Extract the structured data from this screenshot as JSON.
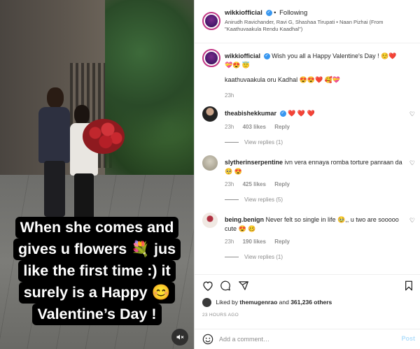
{
  "post": {
    "username": "wikkiofficial",
    "following_label": "Following",
    "song": "Anirudh Ravichander, Ravi G, Shashaa Tirupati • Naan Pizhai (From \"Kaathuvaakula Rendu Kaadhal\")"
  },
  "media": {
    "caption_lines": [
      "When she comes and",
      "gives u flowers 💐 jus",
      "like the first time :) it",
      "surely is a Happy 😊",
      "Valentine’s Day !"
    ],
    "mute_icon": "speaker-muted-icon"
  },
  "caption": {
    "username": "wikkiofficial",
    "text": "Wish you all a Happy Valentine's Day ! ☺️❤️💝😍 😇",
    "line2": "kaathuvaakula oru Kadhal 😍😍❤️ 🥰💝",
    "time": "23h"
  },
  "comments": [
    {
      "username": "theabishekkumar",
      "text": "❤️ ❤️ ❤️",
      "time": "23h",
      "likes": "403 likes",
      "reply": "Reply",
      "view_replies": "View replies (1)"
    },
    {
      "username": "slytherinserpentine",
      "text": "ivn vera ennaya romba torture panraan da 🥺 😍",
      "time": "23h",
      "likes": "425 likes",
      "reply": "Reply",
      "view_replies": "View replies (5)"
    },
    {
      "username": "being.benign",
      "text": "Never felt so single in life 🥹,, u two are sooooo cute 😍 🥴",
      "time": "23h",
      "likes": "190 likes",
      "reply": "Reply",
      "view_replies": "View replies (1)"
    }
  ],
  "likes": {
    "prefix": "Liked by",
    "user": "themugenrao",
    "middle": "and",
    "count": "361,236 others"
  },
  "timestamp": "23 HOURS AGO",
  "add_comment": {
    "placeholder": "Add a comment…",
    "post_label": "Post"
  },
  "colors": {
    "verified": "#3897f0",
    "heart_red": "#ed4956",
    "post_disabled": "#b2dffc"
  }
}
